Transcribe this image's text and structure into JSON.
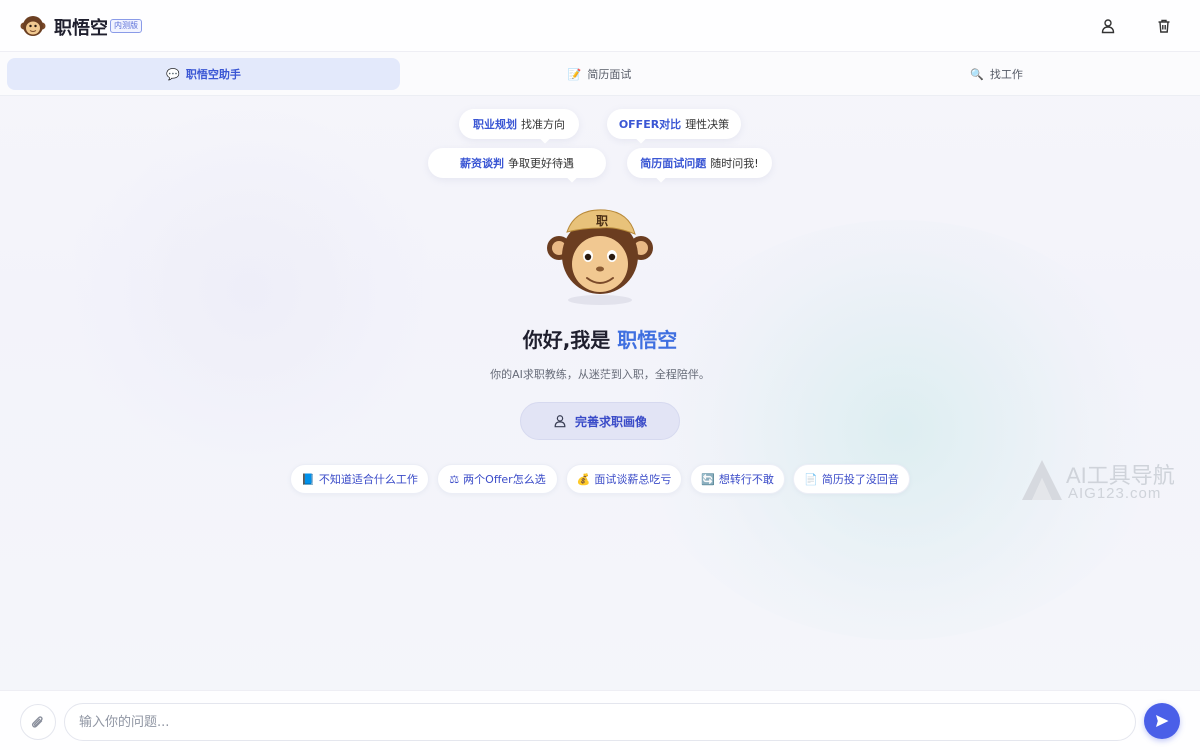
{
  "header": {
    "brand_name": "职悟空",
    "badge": "内测版",
    "logo_icon": "monkey-logo-icon",
    "profile_icon": "user-icon",
    "delete_icon": "trash-icon"
  },
  "tabs": [
    {
      "icon": "💬",
      "label": "职悟空助手",
      "active": true
    },
    {
      "icon": "📝",
      "label": "简历面试",
      "active": false
    },
    {
      "icon": "🔍",
      "label": "找工作",
      "active": false
    }
  ],
  "bubbles": [
    {
      "highlight": "职业规划",
      "text": "找准方向"
    },
    {
      "highlight": "OFFER对比",
      "text": "理性决策"
    },
    {
      "highlight": "薪资谈判",
      "text": "争取更好待遇"
    },
    {
      "highlight": "简历面试问题",
      "text": "随时问我!"
    }
  ],
  "mascot": {
    "hat_char": "职"
  },
  "greeting": {
    "prefix": "你好,我是",
    "brand": "职悟空"
  },
  "subtitle": "你的AI求职教练，从迷茫到入职，全程陪伴。",
  "profile_button": {
    "label": "完善求职画像",
    "icon": "user-icon"
  },
  "chips": [
    {
      "icon": "📘",
      "label": "不知道适合什么工作"
    },
    {
      "icon": "⚖",
      "label": "两个Offer怎么选"
    },
    {
      "icon": "💰",
      "label": "面试谈薪总吃亏"
    },
    {
      "icon": "🔄",
      "label": "想转行不敢"
    },
    {
      "icon": "📄",
      "label": "简历投了没回音"
    }
  ],
  "watermark": {
    "line1": "AI工具导航",
    "line2": "AIG123.com"
  },
  "input": {
    "placeholder": "输入你的问题...",
    "value": ""
  },
  "colors": {
    "accent": "#3a56d4",
    "send": "#4a5fe8",
    "active_tab_bg": "#e3e9fb"
  }
}
